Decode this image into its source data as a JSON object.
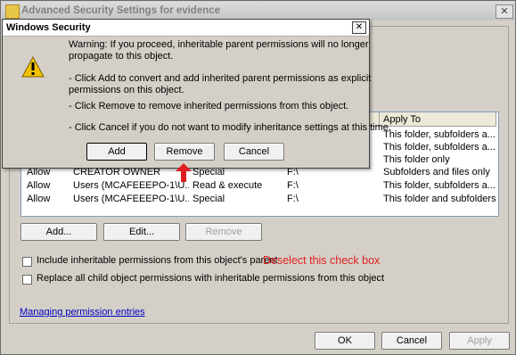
{
  "background_window": {
    "title": "Advanced Security Settings for evidence",
    "close_glyph": "✕",
    "list": {
      "visible_header": "Apply To",
      "rows": [
        {
          "type": "",
          "name": "",
          "permission": "",
          "inherited": "",
          "apply_to": "This folder, subfolders a..."
        },
        {
          "type": "",
          "name": "",
          "permission": "",
          "inherited": "",
          "apply_to": "This folder, subfolders a..."
        },
        {
          "type": "",
          "name": "",
          "permission": "",
          "inherited": "",
          "apply_to": "This folder only"
        },
        {
          "type": "Allow",
          "name": "CREATOR OWNER",
          "permission": "Special",
          "inherited": "F:\\",
          "apply_to": "Subfolders and files only"
        },
        {
          "type": "Allow",
          "name": "Users (MCAFEEEPO-1\\U...",
          "permission": "Read & execute",
          "inherited": "F:\\",
          "apply_to": "This folder, subfolders a..."
        },
        {
          "type": "Allow",
          "name": "Users (MCAFEEEPO-1\\U...",
          "permission": "Special",
          "inherited": "F:\\",
          "apply_to": "This folder and subfolders"
        }
      ]
    },
    "buttons": {
      "add": "Add...",
      "edit": "Edit...",
      "remove": "Remove"
    },
    "checkboxes": {
      "include_inheritable": "Include inheritable permissions from this object's parent",
      "replace_child": "Replace all child object permissions with inheritable permissions from this object"
    },
    "annotation": "Deselect this check box",
    "link": "Managing permission entries",
    "footer": {
      "ok": "OK",
      "cancel": "Cancel",
      "apply": "Apply"
    }
  },
  "dialog": {
    "title": "Windows Security",
    "close_glyph": "✕",
    "message_lines": [
      "Warning: If you proceed, inheritable parent permissions will no longer",
      "propagate to this object.",
      "- Click Add to convert and add inherited parent permissions as explicit",
      "permissions on this object.",
      "- Click Remove to remove inherited permissions from this object.",
      "- Click Cancel if you do not want to modify inheritance settings at this time."
    ],
    "buttons": {
      "add": "Add",
      "remove": "Remove",
      "cancel": "Cancel"
    }
  },
  "colors": {
    "annotation": "#e02020",
    "arrow": "#e02020",
    "link": "#0000c0"
  }
}
